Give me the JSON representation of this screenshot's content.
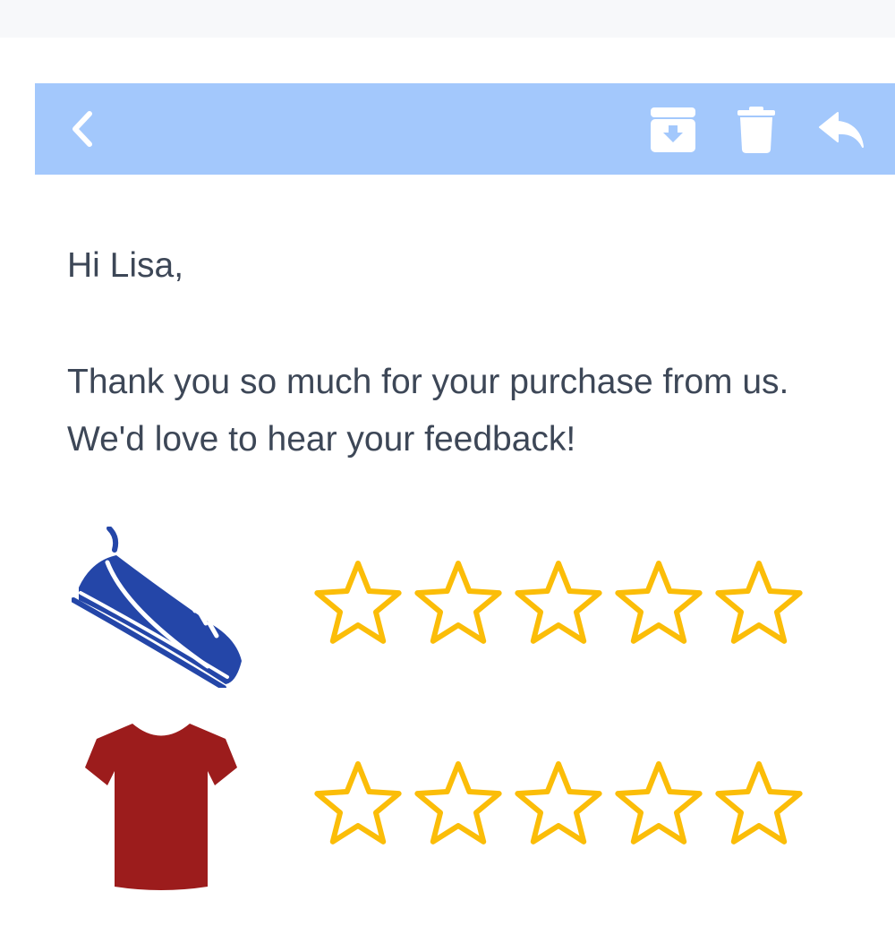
{
  "toolbar": {
    "background": "#a3c8fc",
    "icon_color": "#ffffff",
    "buttons": [
      {
        "icon": "chevron-left-icon",
        "action": "back"
      },
      {
        "icon": "archive-icon",
        "action": "archive"
      },
      {
        "icon": "trash-icon",
        "action": "delete"
      },
      {
        "icon": "reply-icon",
        "action": "reply"
      }
    ]
  },
  "email": {
    "greeting": "Hi Lisa,",
    "body": "Thank you so much for your purchase from us. We'd love to hear your feedback!",
    "text_color": "#3d4757"
  },
  "products": [
    {
      "icon": "sneaker-icon",
      "color": "#2446a8",
      "rating": 0,
      "max_rating": 5
    },
    {
      "icon": "t-shirt-icon",
      "color": "#9c1c1c",
      "rating": 0,
      "max_rating": 5
    }
  ],
  "star_color": "#fbbd08"
}
